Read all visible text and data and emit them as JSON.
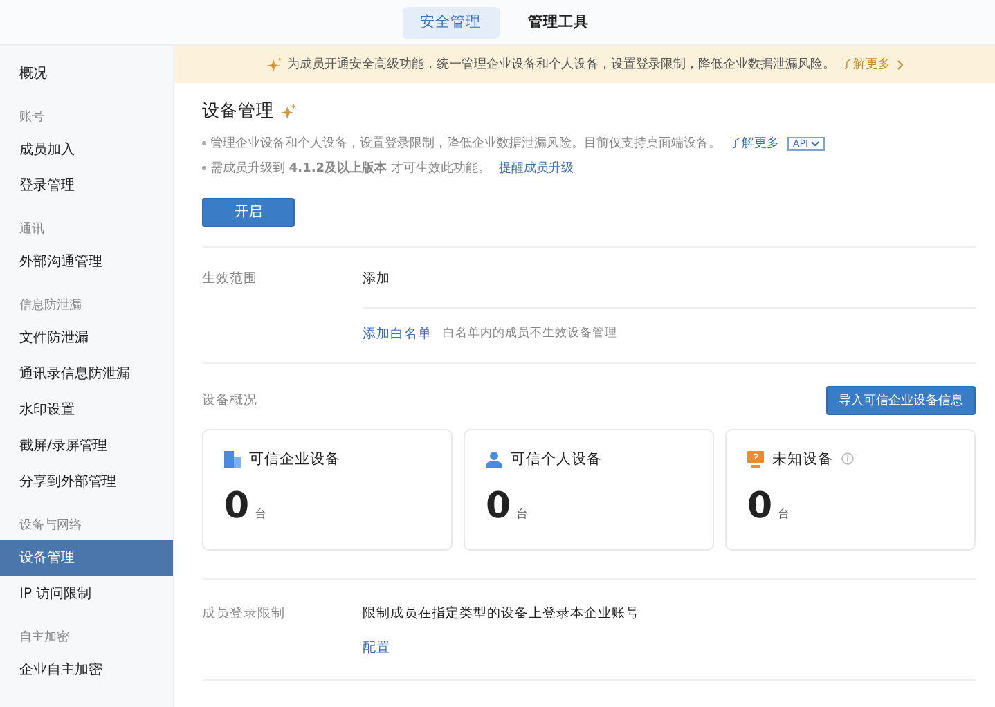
{
  "top_tabs": [
    {
      "label": "安全管理",
      "selected": true
    },
    {
      "label": "管理工具",
      "selected": false
    }
  ],
  "sidebar": {
    "sections": [
      {
        "items": [
          {
            "label": "概况",
            "selected": false
          }
        ]
      },
      {
        "title": "账号",
        "items": [
          {
            "label": "成员加入",
            "selected": false
          },
          {
            "label": "登录管理",
            "selected": false
          }
        ]
      },
      {
        "title": "通讯",
        "items": [
          {
            "label": "外部沟通管理",
            "selected": false
          }
        ]
      },
      {
        "title": "信息防泄漏",
        "items": [
          {
            "label": "文件防泄漏",
            "selected": false
          },
          {
            "label": "通讯录信息防泄漏",
            "selected": false
          },
          {
            "label": "水印设置",
            "selected": false
          },
          {
            "label": "截屏/录屏管理",
            "selected": false
          },
          {
            "label": "分享到外部管理",
            "selected": false
          }
        ]
      },
      {
        "title": "设备与网络",
        "items": [
          {
            "label": "设备管理",
            "selected": true
          },
          {
            "label": "IP 访问限制",
            "selected": false
          }
        ]
      },
      {
        "title": "自主加密",
        "items": [
          {
            "label": "企业自主加密",
            "selected": false
          }
        ]
      }
    ]
  },
  "banner": {
    "text": "为成员开通安全高级功能，统一管理企业设备和个人设备，设置登录限制，降低企业数据泄漏风险。",
    "link": "了解更多"
  },
  "page": {
    "title": "设备管理",
    "notes": [
      {
        "text": "管理企业设备和个人设备，设置登录限制，降低企业数据泄漏风险。目前仅支持桌面端设备。",
        "link": "了解更多",
        "tag": "API"
      },
      {
        "text": "需成员升级到 **4.1.2及以上版本** 才可生效此功能。",
        "link": "提醒成员升级"
      }
    ],
    "enable_button": "开启"
  },
  "scope": {
    "label": "生效范围",
    "add_link": "添加",
    "whitelist_link": "添加白名单",
    "whitelist_note": "白名单内的成员不生效设备管理"
  },
  "overview": {
    "label": "设备概况",
    "import_button": "导入可信企业设备信息",
    "cards": [
      {
        "kind": "enterprise",
        "title": "可信企业设备",
        "count": "0",
        "unit": "台",
        "info": false
      },
      {
        "kind": "personal",
        "title": "可信个人设备",
        "count": "0",
        "unit": "台",
        "info": false
      },
      {
        "kind": "unknown",
        "title": "未知设备",
        "count": "0",
        "unit": "台",
        "info": true
      }
    ]
  },
  "login_limit": {
    "label": "成员登录限制",
    "text": "限制成员在指定类型的设备上登录本企业账号",
    "link": "配置"
  }
}
